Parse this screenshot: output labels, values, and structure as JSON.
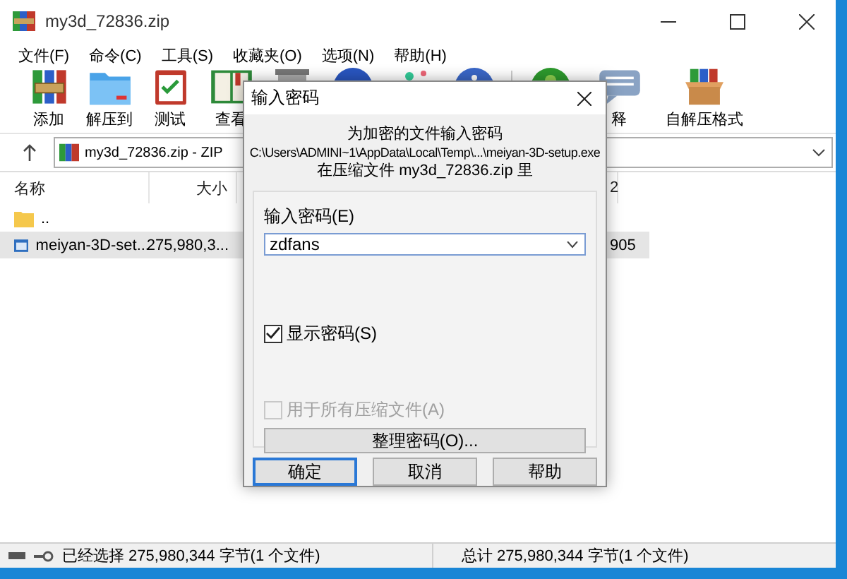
{
  "window": {
    "title": "my3d_72836.zip"
  },
  "menu": [
    {
      "label": "文件(F)"
    },
    {
      "label": "命令(C)"
    },
    {
      "label": "工具(S)"
    },
    {
      "label": "收藏夹(O)"
    },
    {
      "label": "选项(N)"
    },
    {
      "label": "帮助(H)"
    }
  ],
  "toolbar": [
    {
      "kind": "add",
      "label": "添加"
    },
    {
      "kind": "extract",
      "label": "解压到"
    },
    {
      "kind": "test",
      "label": "测试"
    },
    {
      "kind": "view",
      "label": "查看"
    },
    {
      "kind": "delete"
    },
    {
      "kind": "find"
    },
    {
      "kind": "wizard"
    },
    {
      "kind": "info"
    },
    {
      "kind": "separator"
    },
    {
      "kind": "scan"
    },
    {
      "kind": "comment",
      "label": "释"
    },
    {
      "kind": "sfx",
      "label": "自解压格式"
    }
  ],
  "address": {
    "path": "my3d_72836.zip - ZIP"
  },
  "columns": [
    {
      "label": "名称"
    },
    {
      "label": "大小"
    },
    {
      "label": "2"
    }
  ],
  "rows": [
    {
      "kind": "folder",
      "name": "..",
      "selected": false
    },
    {
      "kind": "file",
      "name": "meiyan-3D-set...",
      "size": "275,980,3...",
      "column_3": "905",
      "selected": true
    }
  ],
  "status_bar": {
    "selection": "已经选择 275,980,344 字节(1 个文件)",
    "total": "总计 275,980,344 字节(1 个文件)"
  },
  "dialog": {
    "title": "输入密码",
    "message": [
      "为加密的文件输入密码",
      "C:\\Users\\ADMINI~1\\AppData\\Local\\Temp\\...\\meiyan-3D-setup.exe",
      "在压缩文件 my3d_72836.zip 里"
    ],
    "password_label": "输入密码(E)",
    "password": "zdfans",
    "options": [
      {
        "label": "显示密码(S)",
        "checked": true,
        "disabled": false
      },
      {
        "label": "用于所有压缩文件(A)",
        "checked": false,
        "disabled": true
      }
    ],
    "organize_button": "整理密码(O)...",
    "buttons": [
      {
        "label": "确定",
        "default": true
      },
      {
        "label": "取消",
        "default": false
      },
      {
        "label": "帮助",
        "default": false
      }
    ]
  }
}
